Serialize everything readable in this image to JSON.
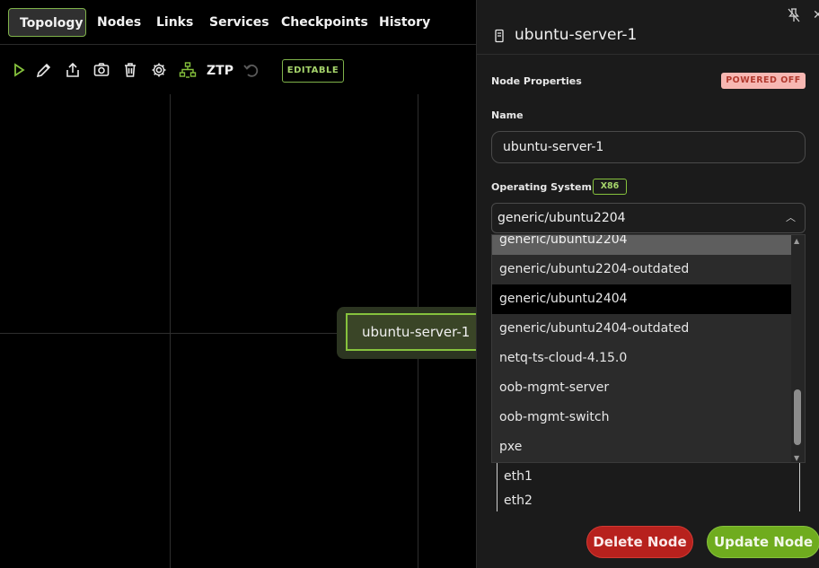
{
  "tabs": [
    {
      "label": "Topology",
      "active": true
    },
    {
      "label": "Nodes"
    },
    {
      "label": "Links"
    },
    {
      "label": "Services"
    },
    {
      "label": "Checkpoints"
    },
    {
      "label": "History"
    }
  ],
  "toolbar": {
    "icons": [
      "play-icon",
      "pencil-icon",
      "share-icon",
      "camera-icon",
      "trash-icon",
      "gear-icon",
      "network-icon",
      "undo-icon"
    ],
    "ztp_label": "ZTP",
    "editable_label": "EDITABLE"
  },
  "canvas": {
    "node_label": "ubuntu-server-1",
    "accent": "#86c23d"
  },
  "panel": {
    "title": "ubuntu-server-1",
    "section_label": "Node Properties",
    "status_badge": "POWERED OFF",
    "name_label": "Name",
    "name_value": "ubuntu-server-1",
    "os_label": "Operating System",
    "arch_badge": "X86",
    "os_value": "generic/ubuntu2204",
    "os_options": [
      "generic/ubuntu2204",
      "generic/ubuntu2204-outdated",
      "generic/ubuntu2404",
      "generic/ubuntu2404-outdated",
      "netq-ts-cloud-4.15.0",
      "oob-mgmt-server",
      "oob-mgmt-switch",
      "pxe"
    ],
    "interfaces": [
      "eth1",
      "eth2"
    ],
    "delete_label": "Delete Node",
    "update_label": "Update Node"
  },
  "colors": {
    "delete": "#b7211d",
    "update": "#6fac1e",
    "powered_off_bg": "#f7b7b2"
  }
}
